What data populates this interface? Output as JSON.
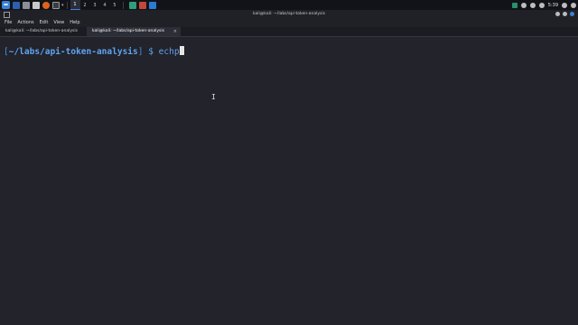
{
  "panel": {
    "workspaces": [
      "1",
      "2",
      "3",
      "4",
      "5"
    ],
    "active_workspace": "1",
    "clock": "5:39",
    "launcher_icons": [
      "kali-menu-icon",
      "show-desktop-icon",
      "files-icon",
      "text-editor-icon",
      "firefox-icon",
      "terminal-icon"
    ],
    "taskbar_icons": [
      "app-icon-1",
      "app-icon-2",
      "vscode-icon"
    ],
    "tray_icons": [
      "network-icon",
      "volume-icon",
      "notification-icon",
      "battery-icon",
      "power-icon"
    ]
  },
  "window": {
    "title": "kali@kali: ~/labs/api-token-analysis"
  },
  "menu": {
    "file": "File",
    "actions": "Actions",
    "edit": "Edit",
    "view": "View",
    "help": "Help"
  },
  "tabs": [
    {
      "label": "kali@kali: ~/labs/api-token-analysis"
    },
    {
      "label": "kali@kali: ~/labs/api-token-analysis",
      "active": true
    }
  ],
  "terminal": {
    "bracket_open": "[",
    "path": "~/labs/api-token-analysis",
    "bracket_close": "]",
    "dollar": "$",
    "command": "echp"
  },
  "colors": {
    "accent": "#3b82d6",
    "background": "#22232b",
    "prompt": "#5fa4f0"
  }
}
